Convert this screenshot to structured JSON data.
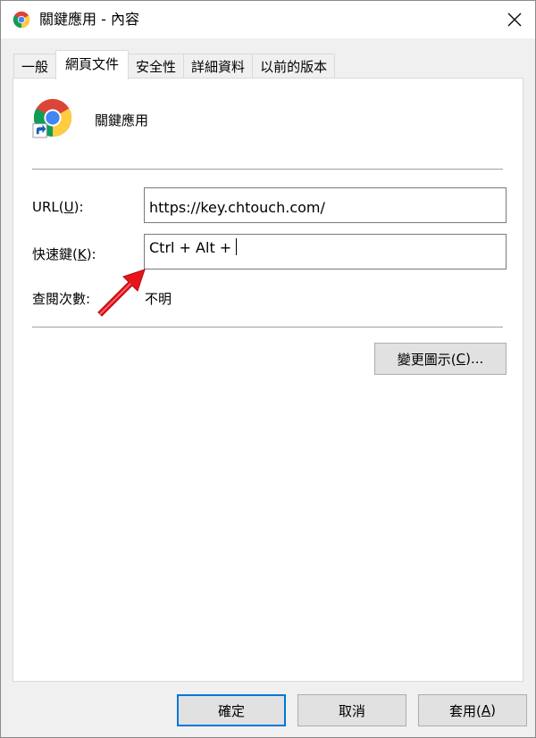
{
  "window": {
    "title": "關鍵應用 - 內容"
  },
  "tabs": [
    {
      "label": "一般"
    },
    {
      "label": "網頁文件"
    },
    {
      "label": "安全性"
    },
    {
      "label": "詳細資料"
    },
    {
      "label": "以前的版本"
    }
  ],
  "active_tab": 1,
  "shortcut": {
    "name": "關鍵應用",
    "url_label_pre": "URL(",
    "url_label_key": "U",
    "url_label_post": "):",
    "url_value": "https://key.chtouch.com/",
    "hotkey_label_pre": "快速鍵(",
    "hotkey_label_key": "K",
    "hotkey_label_post": "):",
    "hotkey_value": "Ctrl + Alt + ",
    "visits_label": "查閱次數:",
    "visits_value": "不明",
    "change_icon_pre": "變更圖示(",
    "change_icon_key": "C",
    "change_icon_post": ")..."
  },
  "footer": {
    "ok_label": "確定",
    "cancel_label": "取消",
    "apply_pre": "套用(",
    "apply_key": "A",
    "apply_post": ")"
  },
  "colors": {
    "accent": "#0078d7",
    "annotation_arrow": "#e8141b"
  },
  "icons": {
    "app": "chrome-icon",
    "shortcut_overlay": "shortcut-arrow-icon",
    "close": "close-icon"
  }
}
